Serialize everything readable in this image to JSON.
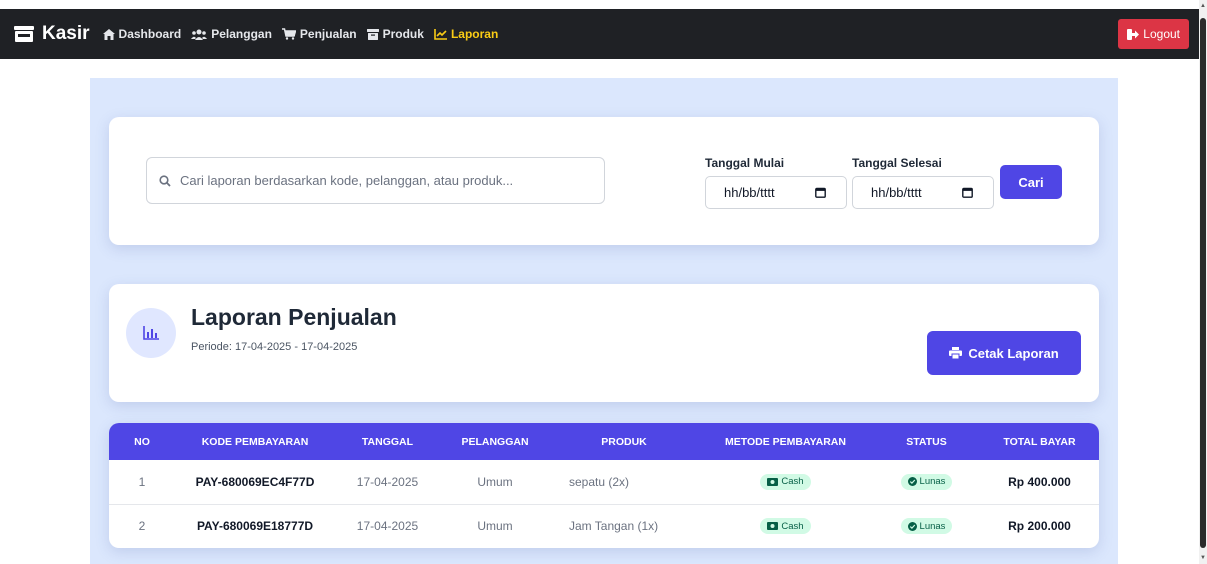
{
  "navbar": {
    "brand": "Kasir",
    "links": [
      {
        "label": "Dashboard",
        "icon": "home-icon"
      },
      {
        "label": "Pelanggan",
        "icon": "users-icon"
      },
      {
        "label": "Penjualan",
        "icon": "cart-icon"
      },
      {
        "label": "Produk",
        "icon": "box-icon"
      },
      {
        "label": "Laporan",
        "icon": "chart-line-icon",
        "active": true
      }
    ],
    "logout_label": "Logout",
    "active_color": "#facc15"
  },
  "search": {
    "placeholder": "Cari laporan berdasarkan kode, pelanggan, atau produk...",
    "start_label": "Tanggal Mulai",
    "start_value": "hh/bb/tttt",
    "end_label": "Tanggal Selesai",
    "end_value": "hh/bb/tttt",
    "button_label": "Cari"
  },
  "report": {
    "title": "Laporan Penjualan",
    "period": "Periode: 17-04-2025 - 17-04-2025",
    "print_label": "Cetak Laporan"
  },
  "table": {
    "headers": [
      "No",
      "Kode Pembayaran",
      "Tanggal",
      "Pelanggan",
      "Produk",
      "Metode Pembayaran",
      "Status",
      "Total Bayar"
    ],
    "rows": [
      {
        "no": "1",
        "kode": "PAY-680069EC4F77D",
        "tanggal": "17-04-2025",
        "pelanggan": "Umum",
        "produk": "sepatu (2x)",
        "metode": "Cash",
        "status": "Lunas",
        "total": "Rp 400.000"
      },
      {
        "no": "2",
        "kode": "PAY-680069E18777D",
        "tanggal": "17-04-2025",
        "pelanggan": "Umum",
        "produk": "Jam Tangan (1x)",
        "metode": "Cash",
        "status": "Lunas",
        "total": "Rp 200.000"
      }
    ]
  },
  "colors": {
    "primary": "#4f46e5",
    "logout": "#dc3545",
    "navbar": "#1f2125",
    "background": "#dbe7fd",
    "badge_bg": "#d1fae5"
  }
}
